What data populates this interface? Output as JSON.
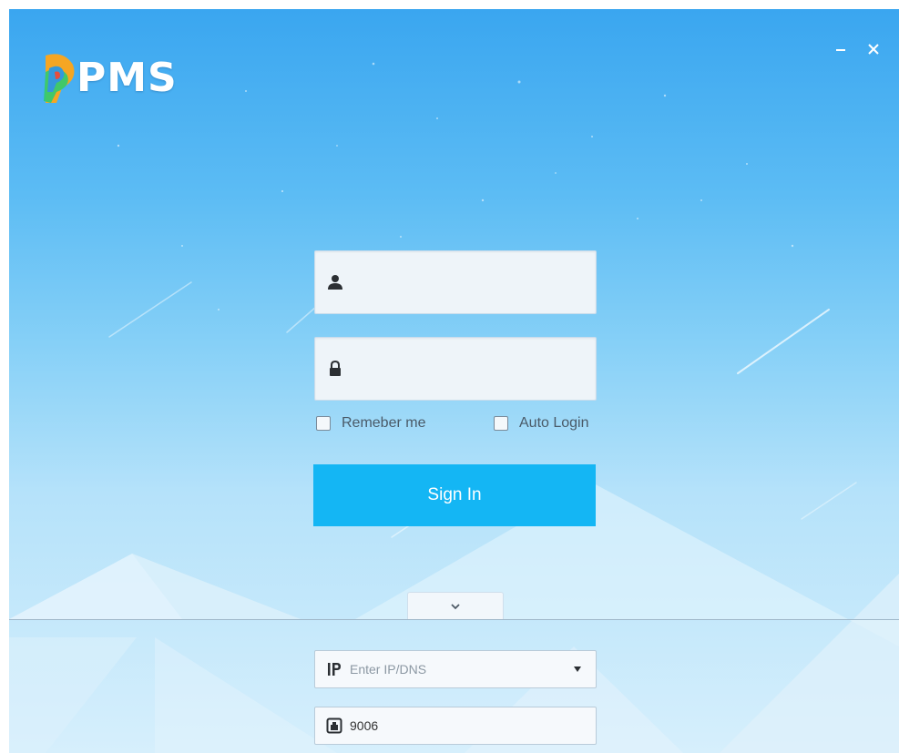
{
  "app": {
    "logo_text": "PMS"
  },
  "window_controls": {
    "minimize_icon": "minimize-icon",
    "close_icon": "close-icon"
  },
  "login": {
    "username": {
      "icon": "user-icon",
      "value": ""
    },
    "password": {
      "icon": "lock-icon",
      "value": ""
    },
    "remember_me": {
      "label": "Remeber me",
      "checked": false
    },
    "auto_login": {
      "label": "Auto Login",
      "checked": false
    },
    "sign_in_label": "Sign In"
  },
  "expand": {
    "icon": "chevron-down-icon"
  },
  "server": {
    "ip_field": {
      "icon": "ip-icon",
      "placeholder": "Enter IP/DNS",
      "value": "",
      "dropdown_icon": "caret-down-icon"
    },
    "port_field": {
      "icon": "port-icon",
      "value": "9006"
    }
  },
  "colors": {
    "sign_in_button": "#14b6f4",
    "background_top": "#3aa6f0",
    "background_bottom": "#d6effc"
  }
}
